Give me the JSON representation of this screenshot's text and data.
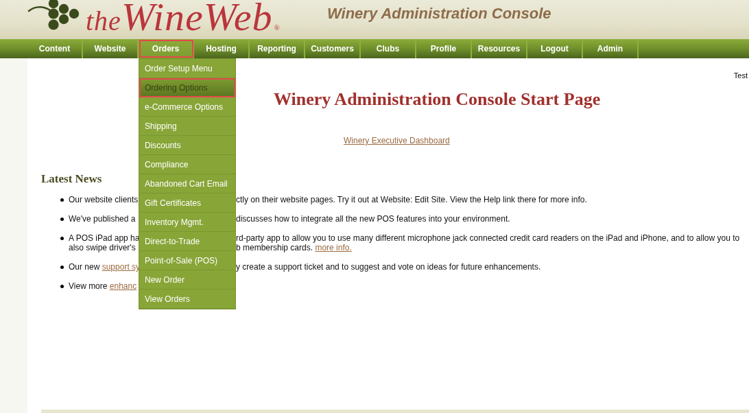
{
  "header": {
    "logo": {
      "prefix": "the",
      "name": "WineWeb",
      "registered": "®"
    },
    "title": "Winery Administration Console"
  },
  "nav": [
    {
      "label": "Content",
      "selected": false
    },
    {
      "label": "Website",
      "selected": false
    },
    {
      "label": "Orders",
      "selected": true
    },
    {
      "label": "Hosting",
      "selected": false
    },
    {
      "label": "Reporting",
      "selected": false
    },
    {
      "label": "Customers",
      "selected": false
    },
    {
      "label": "Clubs",
      "selected": false
    },
    {
      "label": "Profile",
      "selected": false
    },
    {
      "label": "Resources",
      "selected": false
    },
    {
      "label": "Logout",
      "selected": false
    },
    {
      "label": "Admin",
      "selected": false
    }
  ],
  "dropdown": {
    "items": [
      {
        "label": "Order Setup Menu",
        "selected": false
      },
      {
        "label": "Ordering Options",
        "selected": true
      },
      {
        "label": "e-Commerce Options",
        "selected": false
      },
      {
        "label": "Shipping",
        "selected": false
      },
      {
        "label": "Discounts",
        "selected": false
      },
      {
        "label": "Compliance",
        "selected": false
      },
      {
        "label": "Abandoned Cart Email",
        "selected": false
      },
      {
        "label": "Gift Certificates",
        "selected": false
      },
      {
        "label": "Inventory Mgmt.",
        "selected": false
      },
      {
        "label": "Direct-to-Trade",
        "selected": false
      },
      {
        "label": "Point-of-Sale (POS)",
        "selected": false
      },
      {
        "label": "New Order",
        "selected": false
      },
      {
        "label": "View Orders",
        "selected": false
      }
    ]
  },
  "user": "Test",
  "page_title": "Winery Administration Console Start Page",
  "dashboard_link": "Winery Executive Dashboard",
  "news": {
    "heading": "Latest News",
    "items": [
      {
        "left_lines": [
          [
            {
              "kind": "text",
              "text": "Our website clients"
            }
          ]
        ],
        "right_lines": [
          [
            {
              "kind": "text",
              "text": "ctly on their website pages. Try it out at Website: Edit Site. View the Help link there for more info."
            }
          ]
        ]
      },
      {
        "left_lines": [
          [
            {
              "kind": "text",
              "text": "We've published a"
            }
          ]
        ],
        "right_lines": [
          [
            {
              "kind": "text",
              "text": "discusses how to integrate all the new POS features into your environment."
            }
          ]
        ]
      },
      {
        "left_lines": [
          [
            {
              "kind": "text",
              "text": "A POS iPad app ha"
            }
          ],
          [
            {
              "kind": "text",
              "text": "also swipe driver's"
            }
          ]
        ],
        "right_lines": [
          [
            {
              "kind": "text",
              "text": "rd-party app to allow you to use many different microphone jack connected credit card readers on the iPad and iPhone, and to allow you to"
            }
          ],
          [
            {
              "kind": "text",
              "text": "b membership cards. "
            },
            {
              "kind": "link",
              "text": "more info."
            }
          ]
        ]
      },
      {
        "left_lines": [
          [
            {
              "kind": "text",
              "text": "Our new "
            },
            {
              "kind": "link",
              "text": "support sy"
            }
          ]
        ],
        "right_lines": [
          [
            {
              "kind": "text",
              "text": "y create a support ticket and to suggest and vote on ideas for future enhancements."
            }
          ]
        ]
      },
      {
        "left_lines": [
          [
            {
              "kind": "text",
              "text": "View more "
            },
            {
              "kind": "link",
              "text": "enhanc"
            }
          ]
        ]
      }
    ]
  }
}
